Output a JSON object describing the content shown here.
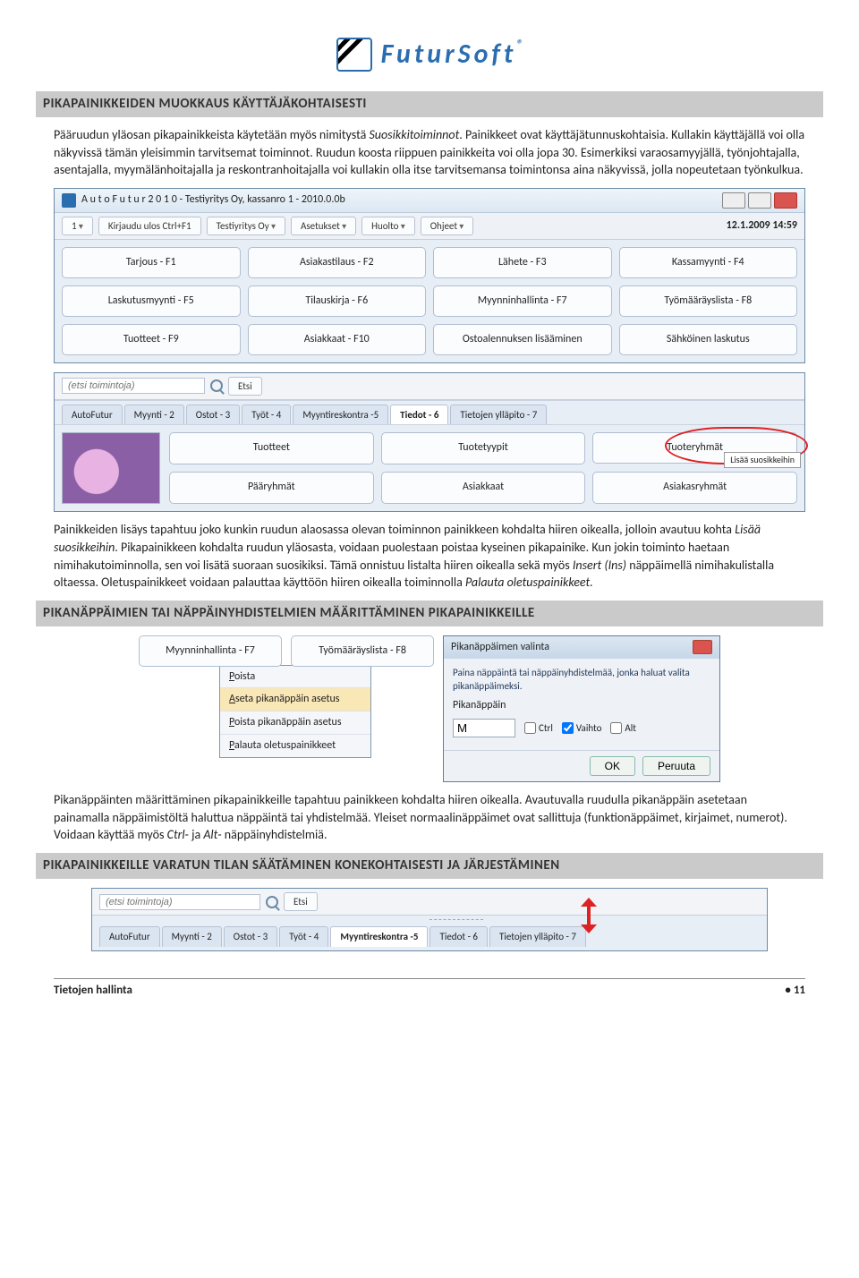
{
  "logo": {
    "text": "FuturSoft",
    "reg": "®"
  },
  "h1": "PIKAPAINIKKEIDEN MUOKKAUS KÄYTTÄJÄKOHTAISESTI",
  "p1a": "Pääruudun yläosan pikapainikkeista käytetään myös nimitystä ",
  "p1b": "Suosikkitoiminnot",
  "p1c": ". Painikkeet ovat käyttäjätunnuskohtaisia. Kullakin käyttäjällä voi olla näkyvissä tämän yleisimmin tarvitsemat toiminnot. Ruudun koosta riippuen painikkeita voi olla jopa 30. Esimerkiksi varaosamyyjällä, työnjohtajalla, asentajalla, myymälänhoitajalla ja reskontranhoitajalla voi kullakin olla itse tarvitsemansa toimintonsa aina näkyvissä, jolla nopeutetaan työnkulkua.",
  "win1": {
    "title": "A u t o F u t u r 2 0 1 0 - Testiyritys Oy, kassanro 1 - 2010.0.0b",
    "tb": {
      "num": "1",
      "logout": "Kirjaudu ulos Ctrl+F1",
      "company": "Testiyritys Oy",
      "settings": "Asetukset",
      "maint": "Huolto",
      "help": "Ohjeet",
      "clock": "12.1.2009 14:59"
    },
    "row1": [
      "Tarjous - F1",
      "Asiakastilaus - F2",
      "Lähete - F3",
      "Kassamyynti - F4"
    ],
    "row2": [
      "Laskutusmyynti - F5",
      "Tilauskirja - F6",
      "Myynninhallinta - F7",
      "Työmääräyslista - F8"
    ],
    "row3": [
      "Tuotteet - F9",
      "Asiakkaat - F10",
      "Ostoalennuksen lisääminen",
      "Sähköinen laskutus"
    ]
  },
  "sub1": {
    "search_ph": "(etsi toimintoja)",
    "search_btn": "Etsi",
    "tabs": [
      "AutoFutur",
      "Myynti - 2",
      "Ostot - 3",
      "Työt - 4",
      "Myyntireskontra -5",
      "Tiedot - 6",
      "Tietojen ylläpito - 7"
    ],
    "grid": [
      "Tuotteet",
      "Tuotetyypit",
      "Tuoteryhmät",
      "Pääryhmät",
      "Asiakkaat",
      "Asiakasryhmät"
    ],
    "tag": "Lisää suosikkeihin"
  },
  "p2a": "Painikkeiden lisäys tapahtuu joko kunkin ruudun alaosassa olevan  toiminnon painikkeen kohdalta hiiren oikealla, jolloin avautuu kohta ",
  "p2b": "Lisää suosikkeihin",
  "p2c": ". Pikapainikkeen kohdalta ruudun yläosasta, voidaan puolestaan poistaa kyseinen pikapainike. Kun jokin toiminto haetaan nimihakutoiminnolla, sen voi lisätä suoraan suosikiksi. Tämä onnistuu listalta hiiren oikealla sekä myös ",
  "p2d": "Insert (Ins)",
  "p2e": " näppäimellä nimihaku­listalla oltaessa. Oletuspainikkeet voidaan palauttaa käyttöön hiiren oikealla toiminnolla ",
  "p2f": "Palauta oletuspainikkeet.",
  "h2": "PIKANÄPPÄIMIEN TAI NÄPPÄINYHDISTELMIEN MÄÄRITTÄMINEN PIKAPAINIKKEILLE",
  "blk2": {
    "btns": [
      "Myynninhallinta - F7",
      "Työmääräyslista - F8"
    ],
    "menu": [
      "Poista",
      "Aseta pikanäppäin asetus",
      "Poista pikanäppäin asetus",
      "Palauta oletuspainikkeet"
    ],
    "dlg": {
      "title": "Pikanäppäimen valinta",
      "hint": "Paina näppäintä tai näppäinyhdistelmää, jonka haluat valita pikanäppäimeksi.",
      "label": "Pikanäppäin",
      "val": "M",
      "ctrl": "Ctrl",
      "shift": "Vaihto",
      "alt": "Alt",
      "ok": "OK",
      "cancel": "Peruuta"
    }
  },
  "p3a": "Pikanäppäinten määrittäminen pikapainikkeille tapahtuu painikkeen kohdalta hiiren oikealla. Avautuvalla ruudulla pikanäppäin asetetaan painamalla näppäimistöltä haluttua näppäintä tai yhdistelmää. Yleiset normaalinäppäimet ovat sallittuja (funktionäppäimet, kirjaimet, numerot). Voidaan käyttää myös ",
  "p3b": "Ctrl",
  "p3c": "- ja ",
  "p3d": "Alt",
  "p3e": "- näppäinyhdistelmiä.",
  "h3": "PIKAPAINIKKEILLE VARATUN TILAN SÄÄTÄMINEN KONEKOHTAISESTI JA JÄRJESTÄMINEN",
  "strip": {
    "search_ph": "(etsi toimintoja)",
    "search_btn": "Etsi",
    "tabs": [
      "AutoFutur",
      "Myynti - 2",
      "Ostot - 3",
      "Työt - 4",
      "Myyntireskontra -5",
      "Tiedot - 6",
      "Tietojen ylläpito - 7"
    ]
  },
  "footer": {
    "left": "Tietojen hallinta",
    "right": "•  11"
  }
}
